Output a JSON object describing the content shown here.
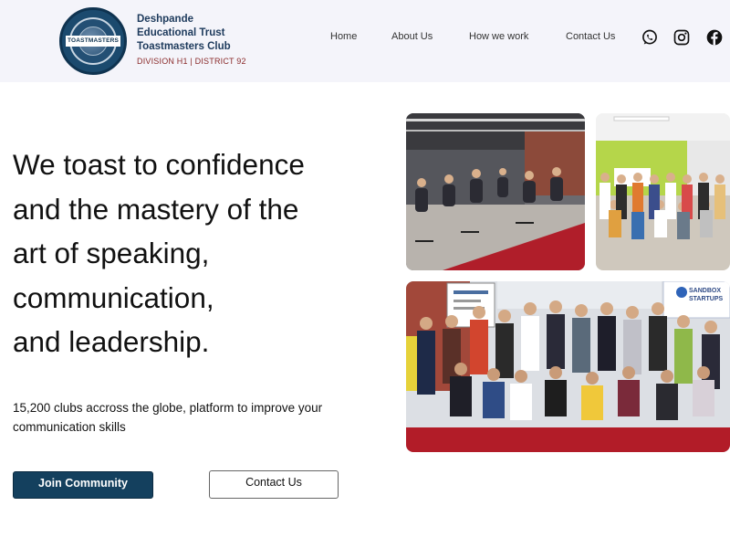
{
  "header": {
    "logo_text": "TOASTMASTERS",
    "brand_lines": [
      "Deshpande",
      "Educational Trust",
      "Toastmasters Club"
    ],
    "brand_sub": "DIVISION H1 | DISTRICT 92"
  },
  "nav": {
    "items": [
      "Home",
      "About Us",
      "How we work",
      "Contact Us"
    ]
  },
  "social": {
    "icons": [
      "whatsapp-icon",
      "instagram-icon",
      "facebook-icon"
    ]
  },
  "hero": {
    "headline_lines": [
      "We toast to confidence",
      "and the mastery of the",
      "art of speaking,",
      "communication,",
      "and leadership."
    ],
    "subtext": "15,200 clubs accross the globe, platform to improve your communication skills",
    "join_button": "Join Community",
    "contact_button": "Contact Us"
  },
  "photos": {
    "photo1": "audience-seated-photo",
    "photo2": "classroom-group-photo",
    "photo3": "group-photo-sandbox-startups",
    "sign_text": "SANDBOX STARTUPS"
  },
  "colors": {
    "header_bg": "#f4f4fa",
    "brand_text": "#1d3a5c",
    "brand_sub": "#8a2a2a",
    "primary_button": "#14405e"
  }
}
